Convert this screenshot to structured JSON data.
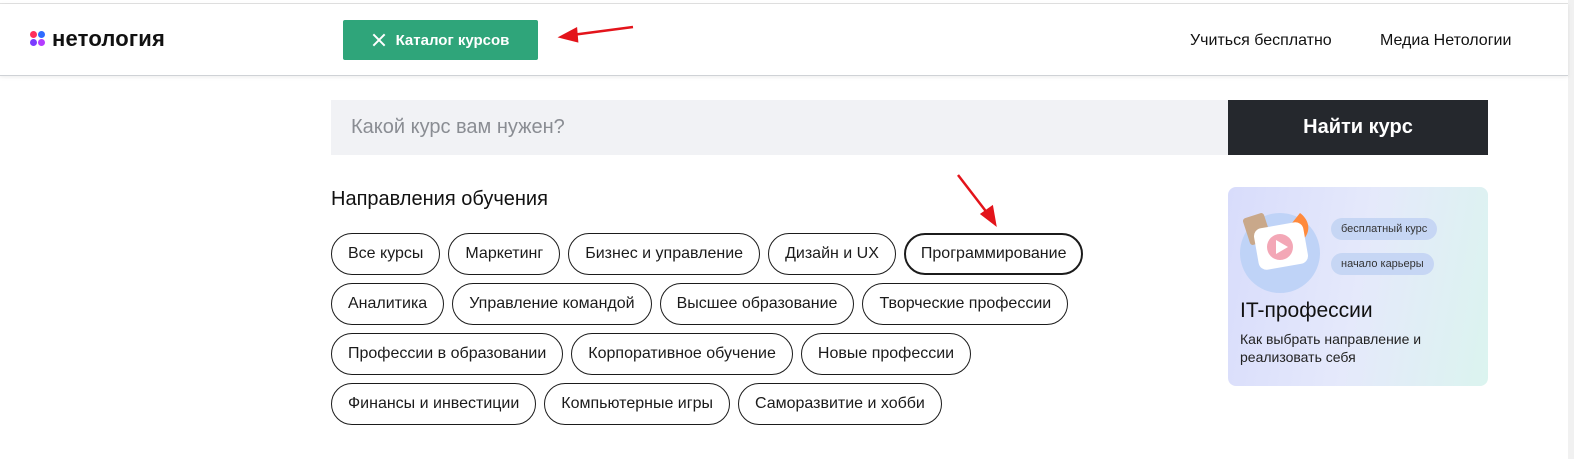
{
  "header": {
    "logo_text": "нетология",
    "catalog_label": "Каталог курсов",
    "nav": [
      {
        "label": "Учиться бесплатно"
      },
      {
        "label": "Медиа Нетологии"
      }
    ]
  },
  "search": {
    "placeholder": "Какой курс вам нужен?",
    "button_label": "Найти курс"
  },
  "directions": {
    "title": "Направления обучения",
    "rows": [
      [
        "Все курсы",
        "Маркетинг",
        "Бизнес и управление",
        "Дизайн и UX",
        "Программирование"
      ],
      [
        "Аналитика",
        "Управление командой",
        "Высшее образование",
        "Творческие профессии"
      ],
      [
        "Профессии в образовании",
        "Корпоративное обучение",
        "Новые профессии"
      ],
      [
        "Финансы и инвестиции",
        "Компьютерные игры",
        "Саморазвитие и хобби"
      ]
    ],
    "selected": "Программирование"
  },
  "promo": {
    "badges": [
      "бесплатный курс",
      "начало карьеры"
    ],
    "title": "IT-профессии",
    "description": "Как выбрать направление и реализовать себя"
  },
  "colors": {
    "catalog_button": "#2fa57a",
    "search_button": "#25282d",
    "annotation_arrow": "#e3141b"
  },
  "icons": [
    "close-icon",
    "logo-dots-icon",
    "play-icon",
    "arrow-annotation"
  ]
}
